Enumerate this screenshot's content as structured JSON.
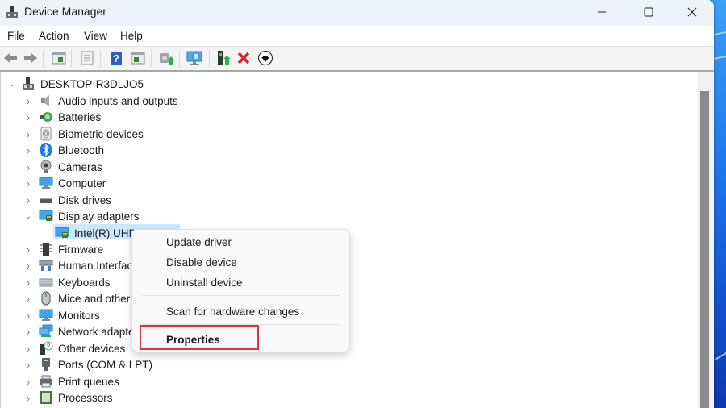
{
  "window": {
    "title": "Device Manager",
    "controls": {
      "minimize": "—",
      "maximize": "☐",
      "close": "✕"
    }
  },
  "menu": [
    "File",
    "Action",
    "View",
    "Help"
  ],
  "toolbar": [
    {
      "icon": "back-arrow-icon"
    },
    {
      "icon": "forward-arrow-icon"
    },
    {
      "icon": "show-hide-console-tree-icon"
    },
    {
      "icon": "properties-sheet-icon"
    },
    {
      "icon": "help-icon"
    },
    {
      "icon": "show-action-pane-icon"
    },
    {
      "icon": "update-driver-icon"
    },
    {
      "icon": "scan-hardware-icon"
    },
    {
      "icon": "enable-device-icon"
    },
    {
      "icon": "uninstall-device-icon"
    },
    {
      "icon": "disable-device-icon"
    }
  ],
  "tree": {
    "root": "DESKTOP-R3DLJO5",
    "categories": [
      {
        "label": "Audio inputs and outputs",
        "icon": "speaker-icon",
        "expanded": false
      },
      {
        "label": "Batteries",
        "icon": "battery-icon",
        "expanded": false
      },
      {
        "label": "Biometric devices",
        "icon": "fingerprint-icon",
        "expanded": false
      },
      {
        "label": "Bluetooth",
        "icon": "bluetooth-icon",
        "expanded": false
      },
      {
        "label": "Cameras",
        "icon": "camera-icon",
        "expanded": false
      },
      {
        "label": "Computer",
        "icon": "computer-icon",
        "expanded": false
      },
      {
        "label": "Disk drives",
        "icon": "disk-drive-icon",
        "expanded": false
      },
      {
        "label": "Display adapters",
        "icon": "display-adapter-icon",
        "expanded": true,
        "children": [
          {
            "label": "Intel(R) UHD",
            "icon": "display-adapter-icon",
            "selected": true
          }
        ]
      },
      {
        "label": "Firmware",
        "icon": "firmware-chip-icon",
        "expanded": false
      },
      {
        "label": "Human Interfac",
        "icon": "hid-icon",
        "expanded": false
      },
      {
        "label": "Keyboards",
        "icon": "keyboard-icon",
        "expanded": false
      },
      {
        "label": "Mice and other",
        "icon": "mouse-icon",
        "expanded": false
      },
      {
        "label": "Monitors",
        "icon": "monitor-icon",
        "expanded": false
      },
      {
        "label": "Network adapte",
        "icon": "network-icon",
        "expanded": false
      },
      {
        "label": "Other devices",
        "icon": "unknown-device-icon",
        "expanded": false
      },
      {
        "label": "Ports (COM & LPT)",
        "icon": "port-icon",
        "expanded": false
      },
      {
        "label": "Print queues",
        "icon": "printer-icon",
        "expanded": false
      },
      {
        "label": "Processors",
        "icon": "processor-icon",
        "expanded": false
      }
    ]
  },
  "context_menu": {
    "items": [
      "Update driver",
      "Disable device",
      "Uninstall device",
      "Scan for hardware changes",
      "Properties"
    ],
    "highlighted": "Properties"
  },
  "colors": {
    "selection": "#cce8ff",
    "annotation_box": "#e0323a",
    "titlebar": "#eef3f9"
  }
}
